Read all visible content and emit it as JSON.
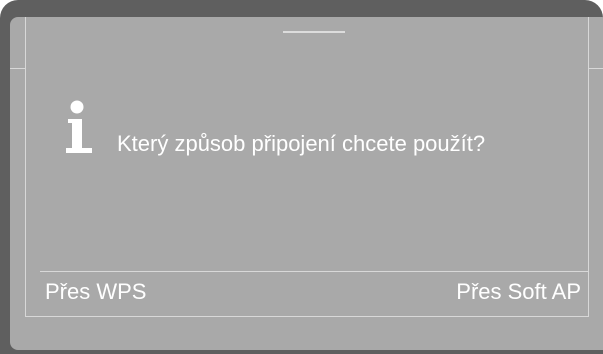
{
  "dialog": {
    "icon": "info-icon",
    "message": "Který způsob připojení chcete použít?"
  },
  "softkeys": {
    "left_label": "Přes WPS",
    "right_label": "Přes Soft AP"
  },
  "colors": {
    "screen_background": "#a9a9a9",
    "bezel": "#5f5f5f",
    "text": "#ffffff"
  }
}
